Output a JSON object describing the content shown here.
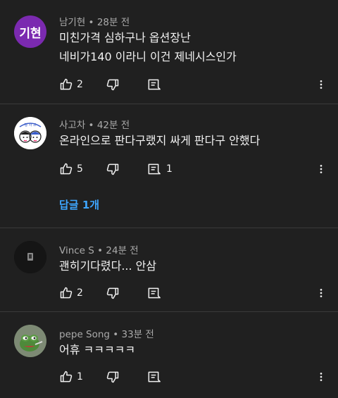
{
  "comments": [
    {
      "avatar": {
        "type": "text",
        "text": "기현",
        "bg": "#7b2ab0"
      },
      "author": "남기현",
      "time": "28분 전",
      "lines": [
        "미친가격 심하구나 옵션장난",
        "네비가140 이라니 이건 제네시스인가"
      ],
      "likes": "2",
      "reply_count": ""
    },
    {
      "avatar": {
        "type": "drawing",
        "bg": "#ffffff"
      },
      "author": "사고차",
      "time": "42분 전",
      "lines": [
        "온라인으로 판다구랬지 싸게 판다구 안했다"
      ],
      "likes": "5",
      "reply_count": "1",
      "replies_link": "답글 1개"
    },
    {
      "avatar": {
        "type": "dark",
        "bg": "#111111"
      },
      "author": "Vince S",
      "time": "24분 전",
      "lines": [
        "괜히기다렸다... 안삼"
      ],
      "likes": "2",
      "reply_count": ""
    },
    {
      "avatar": {
        "type": "frog",
        "bg": "#6a7a62"
      },
      "author": "pepe Song",
      "time": "33분 전",
      "lines": [
        "어휴 ㅋㅋㅋㅋㅋ"
      ],
      "likes": "1",
      "reply_count": ""
    }
  ],
  "separator": " • ",
  "colors": {
    "background": "#202020",
    "link": "#3ea6ff",
    "meta": "#aaaaaa"
  },
  "icons": {
    "like": "thumb-up-icon",
    "dislike": "thumb-down-icon",
    "reply": "comment-icon",
    "more": "more-vert-icon"
  }
}
